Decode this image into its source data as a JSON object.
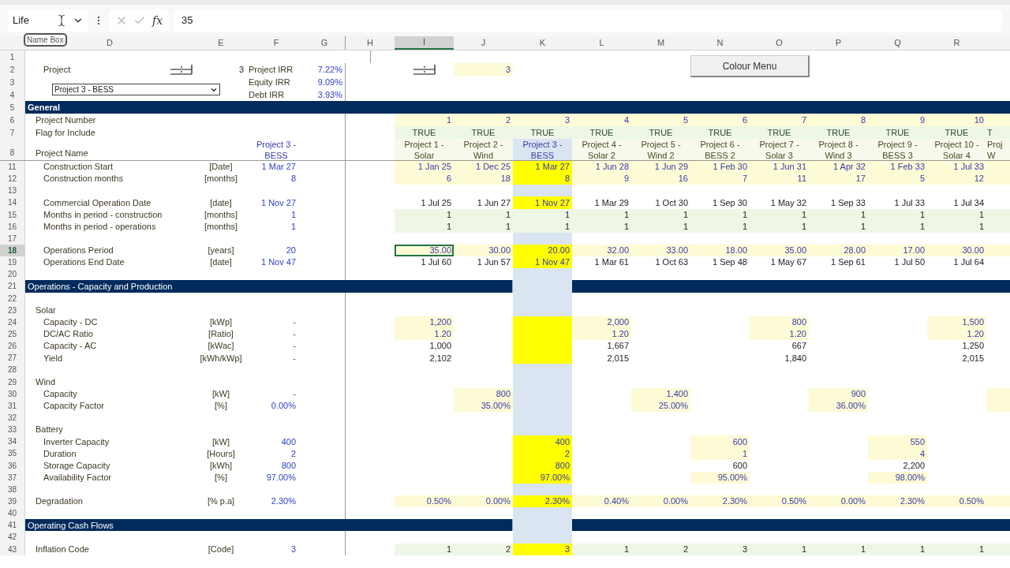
{
  "formula_bar": {
    "name_box": "Life",
    "tooltip": "Name Box",
    "function_label": "fx",
    "value": "35"
  },
  "columns": [
    {
      "label": "D",
      "selected": false
    },
    {
      "label": "E",
      "selected": false
    },
    {
      "label": "F",
      "selected": false
    },
    {
      "label": "G",
      "selected": false
    },
    {
      "label": "H",
      "selected": false
    },
    {
      "label": "I",
      "selected": true
    },
    {
      "label": "J",
      "selected": false
    },
    {
      "label": "K",
      "selected": false
    },
    {
      "label": "L",
      "selected": false
    },
    {
      "label": "M",
      "selected": false
    },
    {
      "label": "N",
      "selected": false
    },
    {
      "label": "O",
      "selected": false
    },
    {
      "label": "P",
      "selected": false
    },
    {
      "label": "Q",
      "selected": false
    },
    {
      "label": "R",
      "selected": false
    }
  ],
  "top_rows": [
    {
      "number": "1",
      "selected": false
    },
    {
      "number": "2",
      "selected": false
    },
    {
      "number": "3",
      "selected": false
    },
    {
      "number": "4",
      "selected": false
    },
    {
      "number": "5",
      "selected": false
    },
    {
      "number": "6",
      "selected": false
    },
    {
      "number": "7",
      "selected": false
    },
    {
      "number": "8",
      "selected": false
    }
  ],
  "control_panel": {
    "project_label": "Project",
    "project_number": "3",
    "dropdown": "Project 3 - BESS",
    "selector_value": "3",
    "colour_button": "Colour Menu",
    "irr": [
      {
        "label": "Project IRR",
        "value": "7.22%"
      },
      {
        "label": "Equity IRR",
        "value": "9.09%"
      },
      {
        "label": "Debt IRR",
        "value": "3.93%"
      }
    ]
  },
  "general": {
    "title": "General",
    "number_label": "Project Number",
    "flag_label": "Flag for Include",
    "name_label": "Project Name",
    "selected_name": [
      "Project 3 -",
      "BESS"
    ]
  },
  "projects": [
    {
      "number": "1",
      "flag": "TRUE",
      "name": [
        "Project 1 -",
        "Solar"
      ],
      "selected": false
    },
    {
      "number": "2",
      "flag": "TRUE",
      "name": [
        "Project 2 -",
        "Wind"
      ],
      "selected": false
    },
    {
      "number": "3",
      "flag": "TRUE",
      "name": [
        "Project 3 -",
        "BESS"
      ],
      "selected": true
    },
    {
      "number": "4",
      "flag": "TRUE",
      "name": [
        "Project 4 -",
        "Solar 2"
      ],
      "selected": false
    },
    {
      "number": "5",
      "flag": "TRUE",
      "name": [
        "Project 5 -",
        "Wind 2"
      ],
      "selected": false
    },
    {
      "number": "6",
      "flag": "TRUE",
      "name": [
        "Project 6 -",
        "BESS 2"
      ],
      "selected": false
    },
    {
      "number": "7",
      "flag": "TRUE",
      "name": [
        "Project 7 -",
        "Solar 3"
      ],
      "selected": false
    },
    {
      "number": "8",
      "flag": "TRUE",
      "name": [
        "Project 8 -",
        "Wind 3"
      ],
      "selected": false
    },
    {
      "number": "9",
      "flag": "TRUE",
      "name": [
        "Project 9 -",
        "BESS 3"
      ],
      "selected": false
    },
    {
      "number": "10",
      "flag": "TRUE",
      "name": [
        "Project 10 -",
        "Solar 4"
      ],
      "selected": false
    }
  ],
  "partial_project": {
    "flag": "T",
    "name": [
      "Proj",
      "W"
    ]
  },
  "rows": [
    {
      "number": "11",
      "selected": false,
      "kind": "data",
      "label": "Construction Start",
      "unit": "[Date]",
      "value": "1 Mar 27",
      "edge_input": true,
      "cells": [
        {
          "text": "1 Jan 25",
          "input": true
        },
        {
          "text": "1 Dec 25",
          "input": true
        },
        {
          "text": "1 Mar 27",
          "input": true
        },
        {
          "text": "1 Jun 28",
          "input": true
        },
        {
          "text": "1 Jun 29",
          "input": true
        },
        {
          "text": "1 Feb 30",
          "input": true
        },
        {
          "text": "1 Jun 31",
          "input": true
        },
        {
          "text": "1 Apr 32",
          "input": true
        },
        {
          "text": "1 Feb 33",
          "input": true
        },
        {
          "text": "1 Jul 33",
          "input": true
        }
      ]
    },
    {
      "number": "12",
      "selected": false,
      "kind": "data",
      "label": "Construction months",
      "unit": "[months]",
      "value": "8",
      "edge_input": true,
      "cells": [
        {
          "text": "6",
          "input": true
        },
        {
          "text": "18",
          "input": true
        },
        {
          "text": "8",
          "input": true
        },
        {
          "text": "9",
          "input": true
        },
        {
          "text": "16",
          "input": true
        },
        {
          "text": "7",
          "input": true
        },
        {
          "text": "11",
          "input": true
        },
        {
          "text": "17",
          "input": true
        },
        {
          "text": "5",
          "input": true
        },
        {
          "text": "12",
          "input": true
        }
      ]
    },
    {
      "number": "13",
      "selected": false,
      "kind": "blank"
    },
    {
      "number": "14",
      "selected": false,
      "kind": "data",
      "label": "Commercial Operation Date",
      "unit": "[date]",
      "value": "1 Nov 27",
      "cells": [
        {
          "text": "1 Jul 25"
        },
        {
          "text": "1 Jun 27"
        },
        {
          "text": "1 Nov 27",
          "input": true
        },
        {
          "text": "1 Mar 29"
        },
        {
          "text": "1 Oct 30"
        },
        {
          "text": "1 Sep 30"
        },
        {
          "text": "1 May 32"
        },
        {
          "text": "1 Sep 33"
        },
        {
          "text": "1 Jul 33"
        },
        {
          "text": "1 Jul 34"
        }
      ]
    },
    {
      "number": "15",
      "selected": false,
      "kind": "data",
      "label": "Months in period - construction",
      "unit": "[months]",
      "value": "1",
      "edge_flag": true,
      "cells": [
        {
          "text": "1",
          "flag": true
        },
        {
          "text": "1",
          "flag": true
        },
        {
          "text": "1",
          "flag": true
        },
        {
          "text": "1",
          "flag": true
        },
        {
          "text": "1",
          "flag": true
        },
        {
          "text": "1",
          "flag": true
        },
        {
          "text": "1",
          "flag": true
        },
        {
          "text": "1",
          "flag": true
        },
        {
          "text": "1",
          "flag": true
        },
        {
          "text": "1",
          "flag": true
        }
      ]
    },
    {
      "number": "16",
      "selected": false,
      "kind": "data",
      "label": "Months in period - operations",
      "unit": "[months]",
      "value": "1",
      "edge_flag": true,
      "cells": [
        {
          "text": "1",
          "flag": true
        },
        {
          "text": "1",
          "flag": true
        },
        {
          "text": "1",
          "flag": true
        },
        {
          "text": "1",
          "flag": true
        },
        {
          "text": "1",
          "flag": true
        },
        {
          "text": "1",
          "flag": true
        },
        {
          "text": "1",
          "flag": true
        },
        {
          "text": "1",
          "flag": true
        },
        {
          "text": "1",
          "flag": true
        },
        {
          "text": "1",
          "flag": true
        }
      ]
    },
    {
      "number": "17",
      "selected": false,
      "kind": "blank"
    },
    {
      "number": "18",
      "selected": true,
      "kind": "data",
      "label": "Operations Period",
      "unit": "[years]",
      "value": "20",
      "edge_input": true,
      "cells": [
        {
          "text": "35.00",
          "input": true
        },
        {
          "text": "30.00",
          "input": true
        },
        {
          "text": "20.00",
          "input": true
        },
        {
          "text": "32.00",
          "input": true
        },
        {
          "text": "33.00",
          "input": true
        },
        {
          "text": "18.00",
          "input": true
        },
        {
          "text": "35.00",
          "input": true
        },
        {
          "text": "28.00",
          "input": true
        },
        {
          "text": "17.00",
          "input": true
        },
        {
          "text": "30.00",
          "input": true
        }
      ]
    },
    {
      "number": "19",
      "selected": false,
      "kind": "data",
      "label": "Operations End Date",
      "unit": "[date]",
      "value": "1 Nov 47",
      "cells": [
        {
          "text": "1 Jul 60"
        },
        {
          "text": "1 Jun 57"
        },
        {
          "text": "1 Nov 47",
          "input": true
        },
        {
          "text": "1 Mar 61"
        },
        {
          "text": "1 Oct 63"
        },
        {
          "text": "1 Sep 48"
        },
        {
          "text": "1 May 67"
        },
        {
          "text": "1 Sep 61"
        },
        {
          "text": "1 Jul 50"
        },
        {
          "text": "1 Jul 64"
        }
      ]
    },
    {
      "number": "20",
      "selected": false,
      "kind": "blank"
    },
    {
      "number": "21",
      "selected": false,
      "kind": "section",
      "label": "Operations - Capacity and Production"
    },
    {
      "number": "22",
      "selected": false,
      "kind": "blank"
    },
    {
      "number": "23",
      "selected": false,
      "kind": "subheading",
      "label": "Solar"
    },
    {
      "number": "24",
      "selected": false,
      "kind": "data",
      "label": "Capacity - DC",
      "unit": "[kWp]",
      "value": "-",
      "cells": [
        {
          "text": "1,200",
          "input": true
        },
        null,
        {
          "input": true
        },
        {
          "text": "2,000",
          "input": true
        },
        null,
        null,
        {
          "text": "800",
          "input": true
        },
        null,
        null,
        {
          "text": "1,500",
          "input": true
        }
      ]
    },
    {
      "number": "25",
      "selected": false,
      "kind": "data",
      "label": "DC/AC Ratio",
      "unit": "[Ratio]",
      "value": "-",
      "cells": [
        {
          "text": "1.20",
          "input": true
        },
        null,
        {
          "input": true
        },
        {
          "text": "1.20",
          "input": true
        },
        null,
        null,
        {
          "text": "1.20",
          "input": true
        },
        null,
        null,
        {
          "text": "1.20",
          "input": true
        }
      ]
    },
    {
      "number": "26",
      "selected": false,
      "kind": "data",
      "label": "Capacity - AC",
      "unit": "[kWac]",
      "value": "-",
      "cells": [
        {
          "text": "1,000"
        },
        null,
        {
          "input": true
        },
        {
          "text": "1,667"
        },
        null,
        null,
        {
          "text": "667"
        },
        null,
        null,
        {
          "text": "1,250"
        }
      ]
    },
    {
      "number": "27",
      "selected": false,
      "kind": "data",
      "label": "Yield",
      "unit": "[kWh/kWp]",
      "value": "-",
      "cells": [
        {
          "text": "2,102"
        },
        null,
        {
          "input": true
        },
        {
          "text": "2,015"
        },
        null,
        null,
        {
          "text": "1,840"
        },
        null,
        null,
        {
          "text": "2,015"
        }
      ]
    },
    {
      "number": "28",
      "selected": false,
      "kind": "blank"
    },
    {
      "number": "29",
      "selected": false,
      "kind": "subheading",
      "label": "Wind"
    },
    {
      "number": "30",
      "selected": false,
      "kind": "data",
      "label": "Capacity",
      "unit": "[kW]",
      "value": "-",
      "edge_input": true,
      "cells": [
        null,
        {
          "text": "800",
          "input": true
        },
        null,
        null,
        {
          "text": "1,400",
          "input": true
        },
        null,
        null,
        {
          "text": "900",
          "input": true
        },
        null,
        null
      ]
    },
    {
      "number": "31",
      "selected": false,
      "kind": "data",
      "label": "Capacity Factor",
      "unit": "[%]",
      "value": "0.00%",
      "edge_input": true,
      "cells": [
        null,
        {
          "text": "35.00%",
          "input": true
        },
        null,
        null,
        {
          "text": "25.00%",
          "input": true
        },
        null,
        null,
        {
          "text": "36.00%",
          "input": true
        },
        null,
        null
      ]
    },
    {
      "number": "32",
      "selected": false,
      "kind": "blank"
    },
    {
      "number": "33",
      "selected": false,
      "kind": "subheading",
      "label": "Battery"
    },
    {
      "number": "34",
      "selected": false,
      "kind": "data",
      "label": "Inverter Capacity",
      "unit": "[kW]",
      "value": "400",
      "cells": [
        null,
        null,
        {
          "text": "400",
          "input": true
        },
        null,
        null,
        {
          "text": "600",
          "input": true
        },
        null,
        null,
        {
          "text": "550",
          "input": true
        },
        null
      ]
    },
    {
      "number": "35",
      "selected": false,
      "kind": "data",
      "label": "Duration",
      "unit": "[Hours]",
      "value": "2",
      "cells": [
        null,
        null,
        {
          "text": "2",
          "input": true
        },
        null,
        null,
        {
          "text": "1",
          "input": true
        },
        null,
        null,
        {
          "text": "4",
          "input": true
        },
        null
      ]
    },
    {
      "number": "36",
      "selected": false,
      "kind": "data",
      "label": "Storage Capacity",
      "unit": "[kWh]",
      "value": "800",
      "cells": [
        null,
        null,
        {
          "text": "800",
          "input": true
        },
        null,
        null,
        {
          "text": "600"
        },
        null,
        null,
        {
          "text": "2,200"
        },
        null
      ]
    },
    {
      "number": "37",
      "selected": false,
      "kind": "data",
      "label": "Availability Factor",
      "unit": "[%]",
      "value": "97.00%",
      "cells": [
        null,
        null,
        {
          "text": "97.00%",
          "input": true
        },
        null,
        null,
        {
          "text": "95.00%",
          "input": true
        },
        null,
        null,
        {
          "text": "98.00%",
          "input": true
        },
        null
      ]
    },
    {
      "number": "38",
      "selected": false,
      "kind": "blank"
    },
    {
      "number": "39",
      "selected": false,
      "kind": "subheading",
      "label": "Degradation",
      "unit": "[% p.a]",
      "value": "2.30%",
      "edge_input": true,
      "cells": [
        {
          "text": "0.50%",
          "input": true
        },
        {
          "text": "0.00%",
          "input": true
        },
        {
          "text": "2.30%",
          "input": true
        },
        {
          "text": "0.40%",
          "input": true
        },
        {
          "text": "0.00%",
          "input": true
        },
        {
          "text": "2.30%",
          "input": true
        },
        {
          "text": "0.50%",
          "input": true
        },
        {
          "text": "0.00%",
          "input": true
        },
        {
          "text": "2.30%",
          "input": true
        },
        {
          "text": "0.50%",
          "input": true
        }
      ]
    },
    {
      "number": "40",
      "selected": false,
      "kind": "blank"
    },
    {
      "number": "41",
      "selected": false,
      "kind": "section",
      "label": "Operating Cash Flows"
    },
    {
      "number": "42",
      "selected": false,
      "kind": "blank"
    },
    {
      "number": "43",
      "selected": false,
      "kind": "subheading",
      "label": "Inflation Code",
      "unit": "[Code]",
      "value": "3",
      "edge_flag": true,
      "cells": [
        {
          "text": "1",
          "flag": true
        },
        {
          "text": "2",
          "flag": true
        },
        {
          "text": "3",
          "input": true
        },
        {
          "text": "1",
          "flag": true
        },
        {
          "text": "2",
          "flag": true
        },
        {
          "text": "3",
          "flag": true
        },
        {
          "text": "1",
          "flag": true
        },
        {
          "text": "1",
          "flag": true
        },
        {
          "text": "1",
          "flag": true
        },
        {
          "text": "1",
          "flag": true
        }
      ]
    }
  ]
}
